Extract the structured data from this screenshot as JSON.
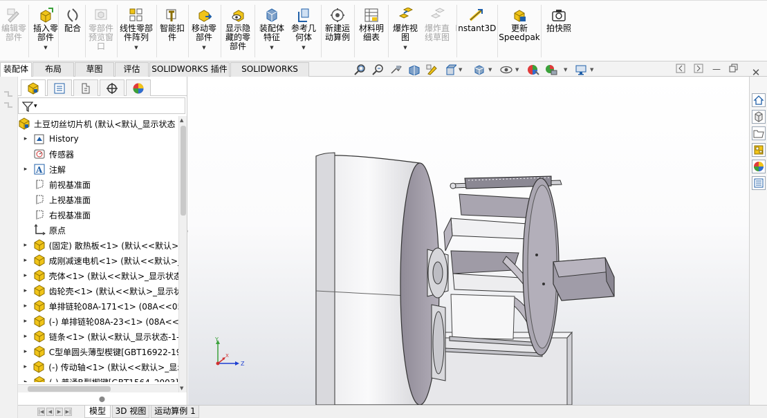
{
  "ribbon": {
    "buttons": [
      {
        "id": "edit-component",
        "label": "编辑零\n部件",
        "disabled": true,
        "has_drop": false
      },
      {
        "id": "insert-component",
        "label": "插入零\n部件",
        "disabled": false,
        "has_drop": true
      },
      {
        "id": "mate",
        "label": "配合",
        "disabled": false,
        "has_drop": false
      },
      {
        "id": "component-preview",
        "label": "零部件\n预览窗\n口",
        "disabled": true,
        "has_drop": false
      },
      {
        "id": "linear-pattern",
        "label": "线性零部\n件阵列",
        "disabled": false,
        "has_drop": true
      },
      {
        "id": "smart-fasteners",
        "label": "智能扣\n件",
        "disabled": false,
        "has_drop": false
      },
      {
        "id": "move-component",
        "label": "移动零\n部件",
        "disabled": false,
        "has_drop": true
      },
      {
        "id": "show-hidden",
        "label": "显示隐\n藏的零\n部件",
        "disabled": false,
        "has_drop": false
      },
      {
        "id": "assembly-feature",
        "label": "装配体\n特征",
        "disabled": false,
        "has_drop": true
      },
      {
        "id": "reference-geometry",
        "label": "参考几\n何体",
        "disabled": false,
        "has_drop": true
      },
      {
        "id": "new-motion-study",
        "label": "新建运\n动算例",
        "disabled": false,
        "has_drop": false
      },
      {
        "id": "bom",
        "label": "材料明\n细表",
        "disabled": false,
        "has_drop": false
      },
      {
        "id": "exploded-view",
        "label": "爆炸视\n图",
        "disabled": false,
        "has_drop": true
      },
      {
        "id": "explode-line-sketch",
        "label": "爆炸直\n线草图",
        "disabled": true,
        "has_drop": false
      },
      {
        "id": "instant3d",
        "label": "Instant3D",
        "disabled": false,
        "has_drop": false
      },
      {
        "id": "update-speedpak",
        "label": "更新\nSpeedpak",
        "disabled": false,
        "has_drop": false
      },
      {
        "id": "snapshot",
        "label": "拍快照",
        "disabled": false,
        "has_drop": false
      }
    ]
  },
  "command_tabs": [
    "装配体",
    "布局",
    "草图",
    "评估",
    "SOLIDWORKS 插件",
    "SOLIDWORKS MBD"
  ],
  "active_command_tab": 0,
  "tree": {
    "root": "土豆切丝切片机 (默认<默认_显示状态",
    "items": [
      {
        "label": "History",
        "icon": "history-icon",
        "expand": true
      },
      {
        "label": "传感器",
        "icon": "sensor-icon",
        "expand": false
      },
      {
        "label": "注解",
        "icon": "annotation-icon",
        "expand": true
      },
      {
        "label": "前视基准面",
        "icon": "plane-icon",
        "expand": false
      },
      {
        "label": "上视基准面",
        "icon": "plane-icon",
        "expand": false
      },
      {
        "label": "右视基准面",
        "icon": "plane-icon",
        "expand": false
      },
      {
        "label": "原点",
        "icon": "origin-icon",
        "expand": false
      },
      {
        "label": "(固定) 散热板<1> (默认<<默认>_",
        "icon": "part-icon",
        "expand": true
      },
      {
        "label": "成刚减速电机<1> (默认<<默认>_",
        "icon": "part-icon",
        "expand": true
      },
      {
        "label": "壳体<1> (默认<<默认>_显示状态",
        "icon": "part-icon",
        "expand": true
      },
      {
        "label": "齿轮壳<1> (默认<<默认>_显示状",
        "icon": "part-icon",
        "expand": true
      },
      {
        "label": "单排链轮08A-171<1> (08A<<05",
        "icon": "part-icon",
        "expand": true
      },
      {
        "label": "(-) 单排链轮08A-23<1> (08A<<(",
        "icon": "part-icon",
        "expand": true
      },
      {
        "label": "链条<1> (默认<默认_显示状态-1-",
        "icon": "part-icon",
        "expand": true
      },
      {
        "label": "C型单圆头薄型楔键[GBT16922-19",
        "icon": "part-icon",
        "expand": true
      },
      {
        "label": "(-) 传动轴<1> (默认<<默认>_显示",
        "icon": "part-icon",
        "expand": true
      },
      {
        "label": "(-) 普通B型楔键[GBT1564_2003]",
        "icon": "part-icon",
        "expand": true
      }
    ]
  },
  "bottom_tabs": [
    "模型",
    "3D 视图",
    "运动算例 1"
  ],
  "active_bottom_tab": 0,
  "triad": {
    "x": "X",
    "y": "Y",
    "z": "Z"
  },
  "colors": {
    "accent_blue": "#1f5fa8",
    "part_yellow": "#f0c419",
    "model_gray": "#a9a5b0",
    "viewport_bottom": "#dfe1e6"
  }
}
